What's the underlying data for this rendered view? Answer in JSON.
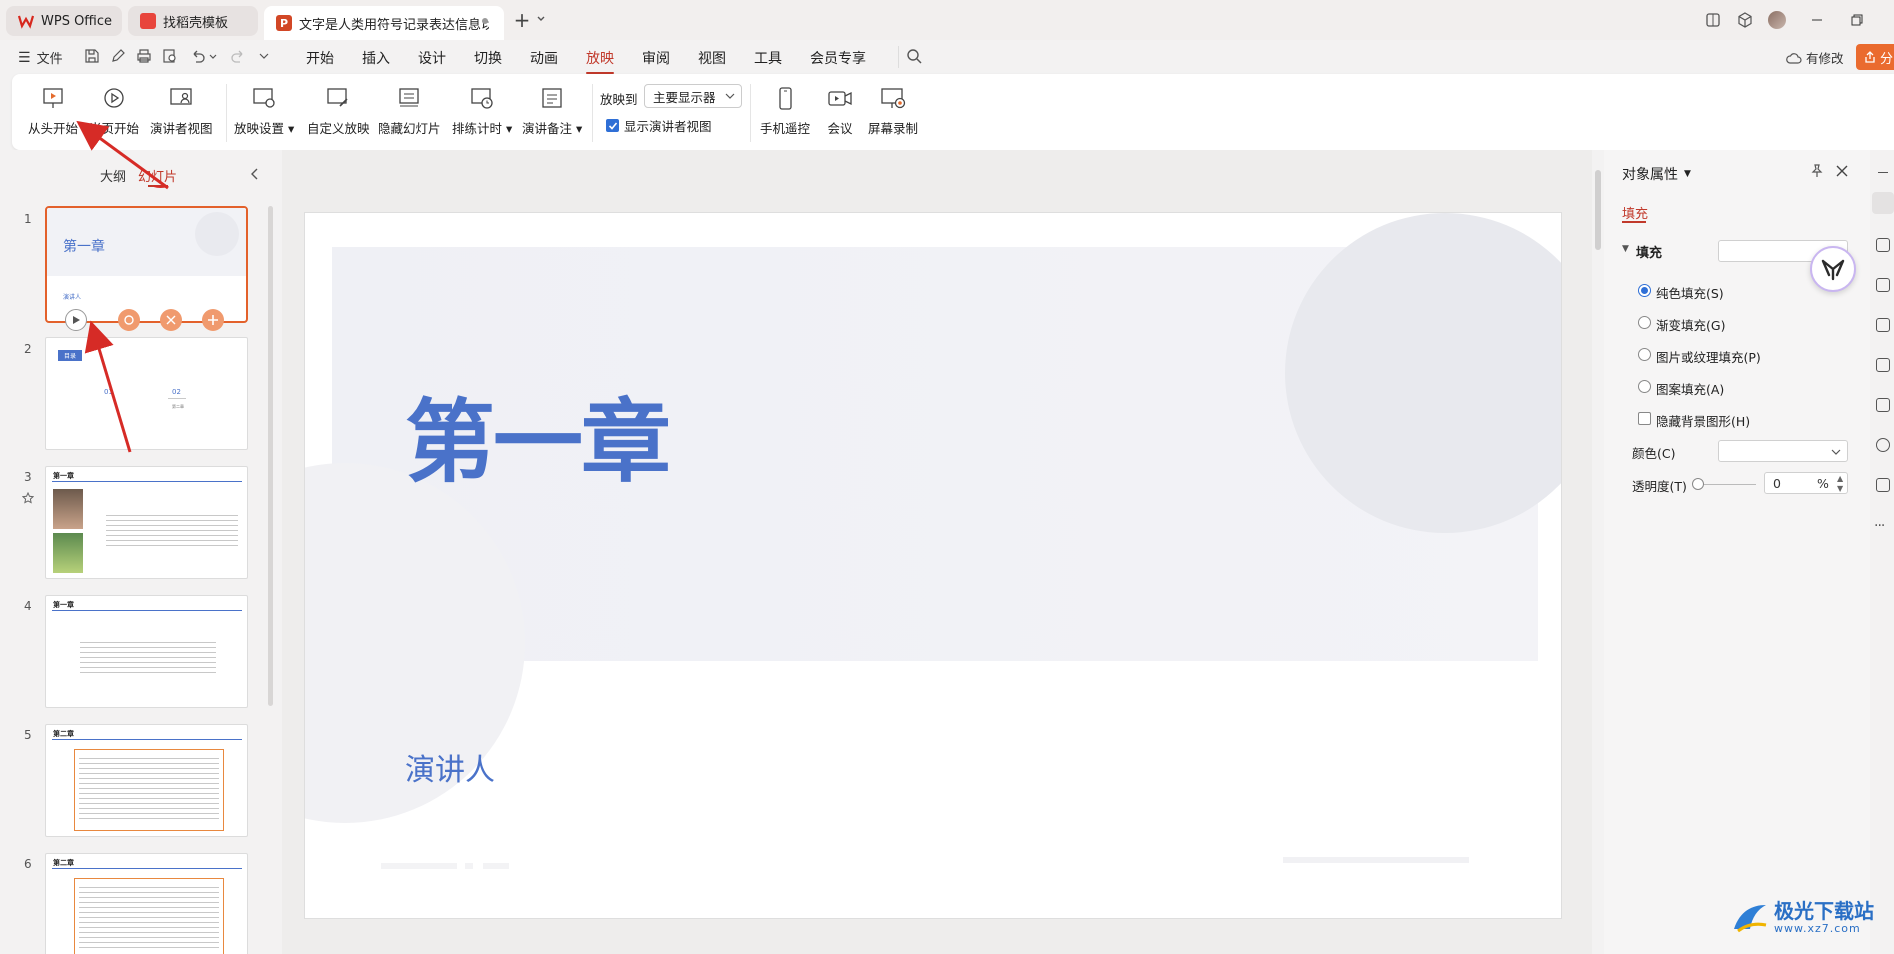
{
  "tabs": [
    {
      "label": "WPS Office"
    },
    {
      "label": "找稻壳模板"
    },
    {
      "label": "文字是人类用符号记录表达信息以"
    }
  ],
  "menubar": {
    "file": "文件",
    "items": [
      "开始",
      "插入",
      "设计",
      "切换",
      "动画",
      "放映",
      "审阅",
      "视图",
      "工具",
      "会员专享"
    ],
    "active_item": "放映",
    "edit_status": "有修改",
    "share": "分"
  },
  "ribbon": {
    "from_start": "从头开始",
    "from_current": "当页开始",
    "presenter_view": "演讲者视图",
    "slideshow_settings": "放映设置",
    "custom_show": "自定义放映",
    "hide_slide": "隐藏幻灯片",
    "rehearse": "排练计时",
    "speaker_notes": "演讲备注",
    "show_on_label": "放映到",
    "show_on_value": "主要显示器",
    "show_presenter_view": "显示演讲者视图",
    "phone_remote": "手机遥控",
    "meeting": "会议",
    "screen_record": "屏幕录制"
  },
  "left_panel": {
    "tab_outline": "大纲",
    "tab_slides": "幻灯片",
    "slides": [
      {
        "num": "1",
        "title": "第一章",
        "subtitle": "演讲人"
      },
      {
        "num": "2",
        "title": "目录",
        "items": [
          "01",
          "02"
        ],
        "item_label": "第二章"
      },
      {
        "num": "3",
        "title": "第一章"
      },
      {
        "num": "4",
        "title": "第一章"
      },
      {
        "num": "5",
        "title": "第二章"
      },
      {
        "num": "6",
        "title": "第二章"
      }
    ]
  },
  "slide": {
    "title": "第一章",
    "subtitle": "演讲人"
  },
  "properties": {
    "header": "对象属性",
    "tab_fill": "填充",
    "section_fill": "填充",
    "options": [
      "纯色填充(S)",
      "渐变填充(G)",
      "图片或纹理填充(P)",
      "图案填充(A)"
    ],
    "selected_option": "纯色填充(S)",
    "hide_bg": "隐藏背景图形(H)",
    "color_label": "颜色(C)",
    "transparency_label": "透明度(T)",
    "transparency_value": "0",
    "transparency_unit": "%"
  },
  "watermark": {
    "site_name": "极光下载站",
    "url": "www.xz7.com"
  },
  "colors": {
    "accent": "#c1392b",
    "slide_title": "#4a72c9",
    "selection": "#e3612b",
    "arrow": "#d62b26"
  }
}
